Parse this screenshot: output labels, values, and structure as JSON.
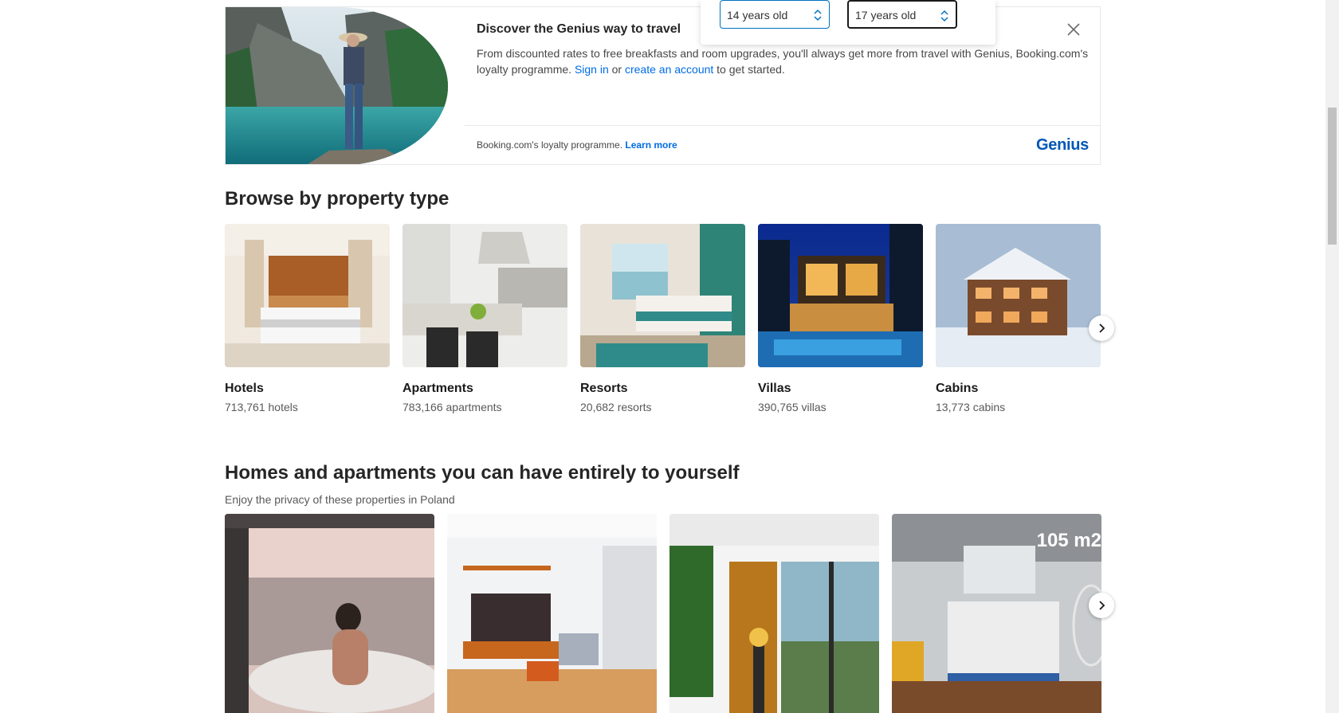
{
  "age_selector": {
    "child1_age": "14 years old",
    "child2_age": "17 years old"
  },
  "genius_banner": {
    "title": "Discover the Genius way to travel",
    "text_before": "From discounted rates to free breakfasts and room upgrades, you'll always get more from travel with Genius, Booking.com's loyalty programme.",
    "sign_in": "Sign in",
    "or": "or",
    "create_account": "create an account",
    "text_after": "to get started.",
    "footer_text": "Booking.com's loyalty programme.",
    "learn_more": "Learn more",
    "logo": "Genius",
    "close_icon": "close-icon"
  },
  "property_types": {
    "heading": "Browse by property type",
    "items": [
      {
        "name": "Hotels",
        "count": "713,761 hotels"
      },
      {
        "name": "Apartments",
        "count": "783,166 apartments"
      },
      {
        "name": "Resorts",
        "count": "20,682 resorts"
      },
      {
        "name": "Villas",
        "count": "390,765 villas"
      },
      {
        "name": "Cabins",
        "count": "13,773 cabins"
      }
    ],
    "next_icon": "chevron-right-icon"
  },
  "homes": {
    "heading": "Homes and apartments you can have entirely to yourself",
    "subheading": "Enjoy the privacy of these properties in Poland",
    "overlay_text": "105 m2",
    "next_icon": "chevron-right-icon"
  },
  "colors": {
    "link": "#006ce4",
    "genius": "#0057b8",
    "focus_border": "#0071c2"
  }
}
